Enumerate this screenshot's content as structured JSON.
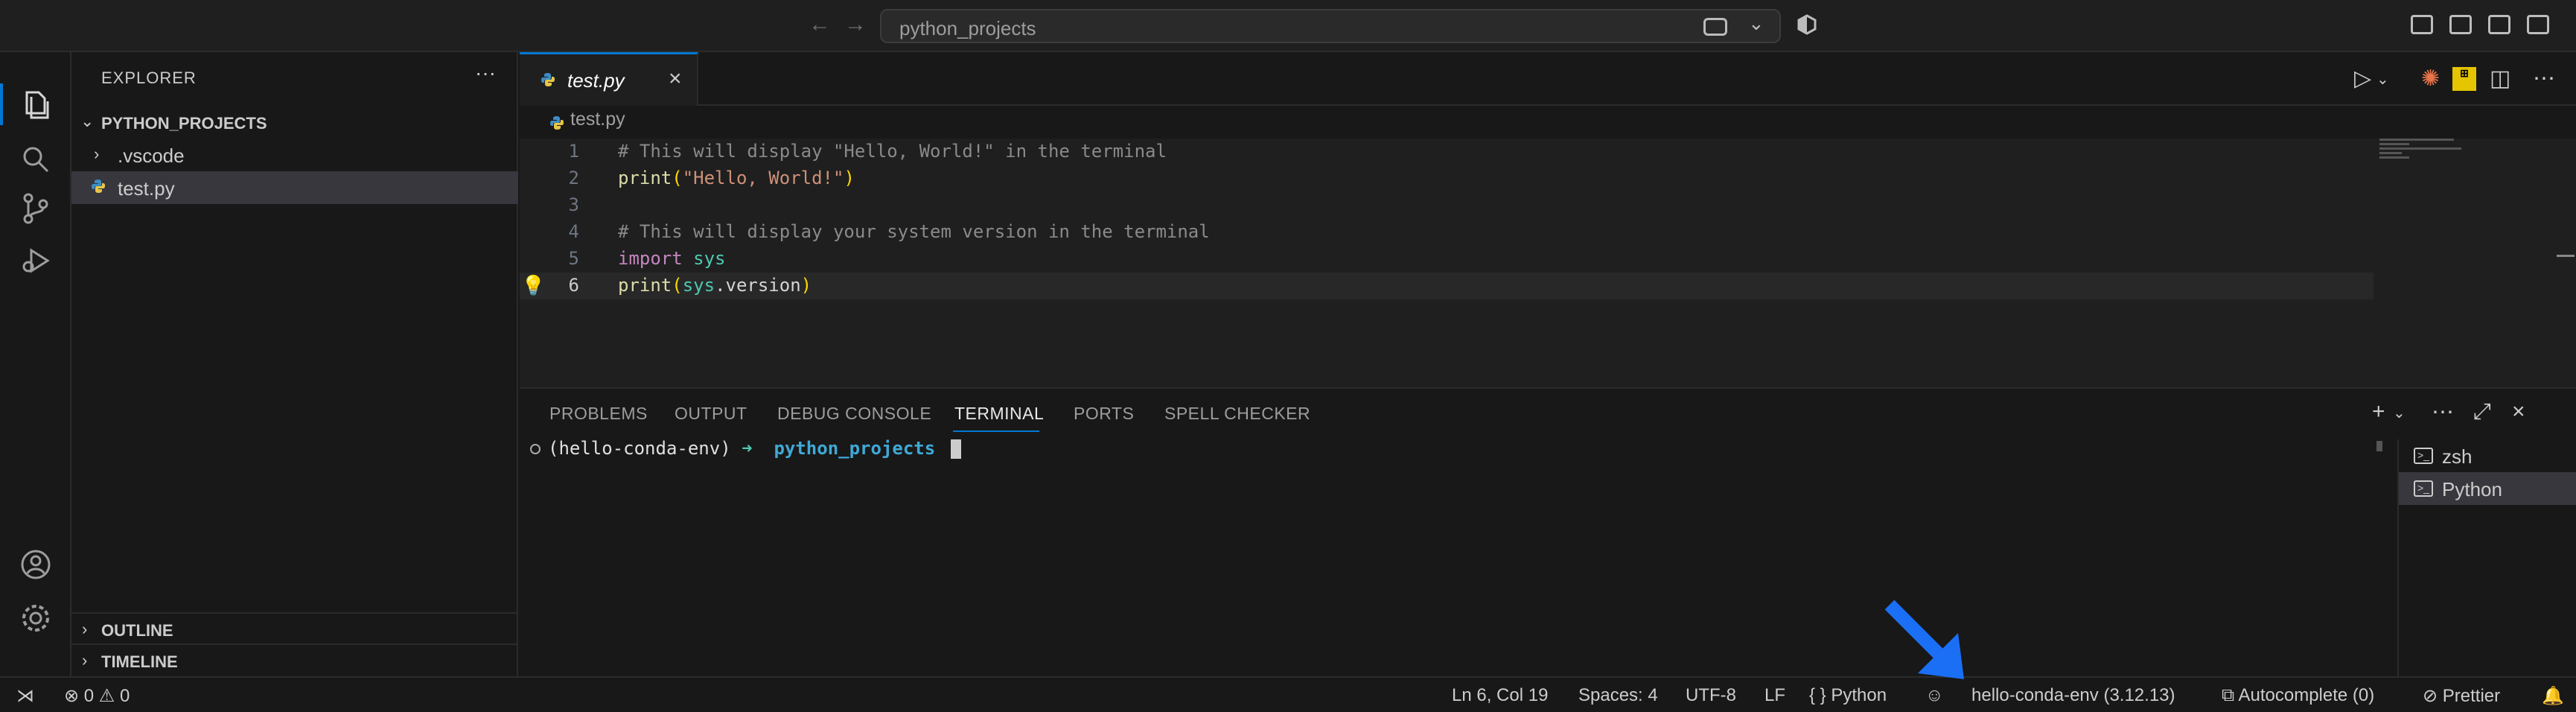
{
  "titlebar": {
    "search_text": "python_projects"
  },
  "sidebar": {
    "title": "EXPLORER",
    "more": "···",
    "root": "PYTHON_PROJECTS",
    "items": [
      {
        "label": ".vscode",
        "type": "folder"
      },
      {
        "label": "test.py",
        "type": "file",
        "selected": true
      }
    ],
    "sections": [
      "OUTLINE",
      "TIMELINE"
    ]
  },
  "editor": {
    "tab_label": "test.py",
    "breadcrumb": "test.py",
    "current_line": 6,
    "lines": [
      {
        "num": "1",
        "text": "# This will display \"Hello, World!\" in the terminal"
      },
      {
        "num": "2",
        "text": "print(\"Hello, World!\")"
      },
      {
        "num": "3",
        "text": ""
      },
      {
        "num": "4",
        "text": "# This will display your system version in the terminal"
      },
      {
        "num": "5",
        "text": "import sys"
      },
      {
        "num": "6",
        "text": "print(sys.version)"
      }
    ]
  },
  "panel": {
    "tabs": [
      "PROBLEMS",
      "OUTPUT",
      "DEBUG CONSOLE",
      "TERMINAL",
      "PORTS",
      "SPELL CHECKER"
    ],
    "active_tab": "TERMINAL",
    "terminal": {
      "env": "(hello-conda-env)",
      "arrow": "➜",
      "dir": "python_projects"
    },
    "terminals": [
      {
        "label": "zsh",
        "selected": false
      },
      {
        "label": "Python",
        "selected": true
      }
    ]
  },
  "statusbar": {
    "errors": "0",
    "warnings": "0",
    "position": "Ln 6, Col 19",
    "spaces": "Spaces: 4",
    "encoding": "UTF-8",
    "eol": "LF",
    "language": "Python",
    "interpreter": "hello-conda-env (3.12.13)",
    "autocomplete": "Autocomplete (0)",
    "prettier": "Prettier"
  },
  "colors": {
    "accent": "#0078d4",
    "annotation_arrow": "#1a6ff5"
  }
}
